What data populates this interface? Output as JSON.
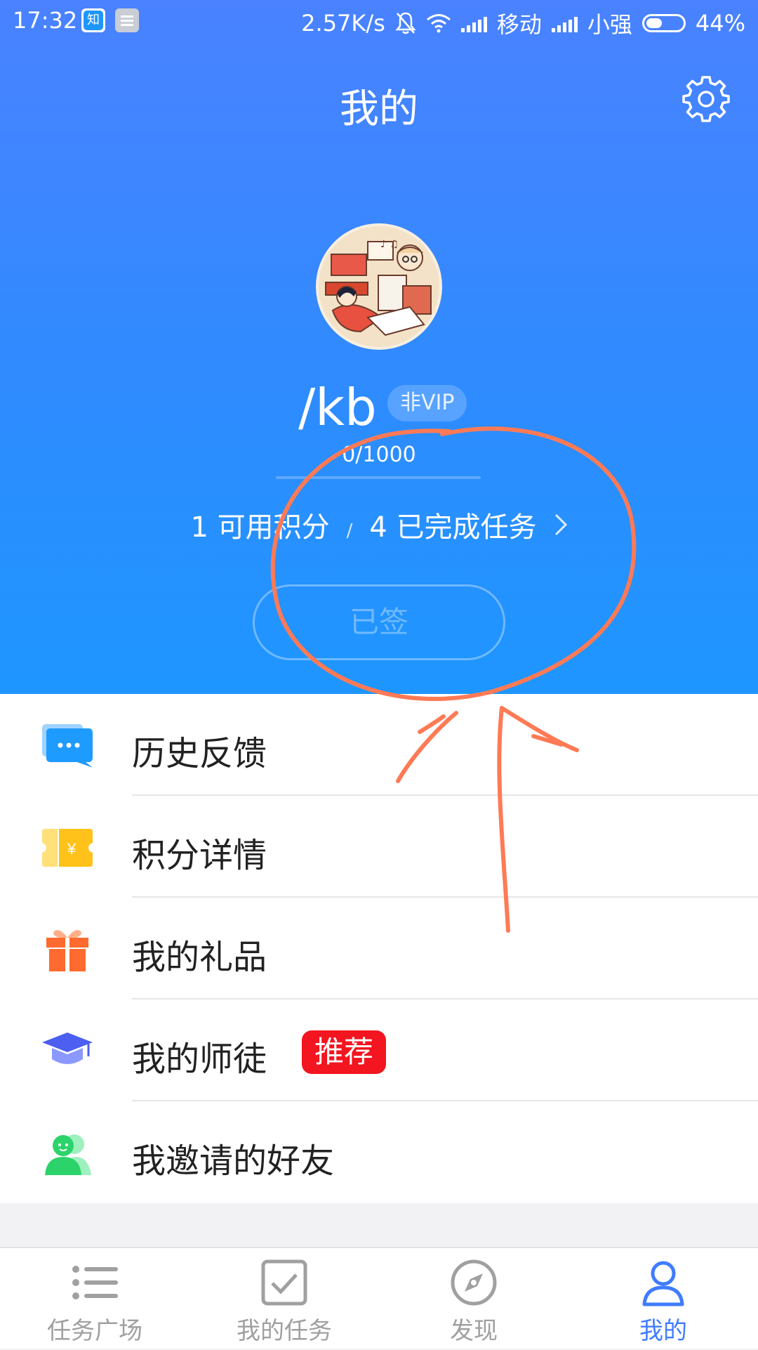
{
  "status_bar": {
    "time": "17:32",
    "notification_app_label": "知",
    "net_speed": "2.57K/s",
    "carrier1": "移动",
    "carrier2": "小强",
    "battery_level": 0.44,
    "battery_text": "44%"
  },
  "header": {
    "title": "我的",
    "settings_icon": "gear-icon",
    "username": "/kb",
    "vip_badge": "非VIP",
    "progress_text": "0/1000",
    "progress_value": 0,
    "points_label": "1 可用积分",
    "separator": "/",
    "tasks_label": "4 已完成任务",
    "signin_button": "已签"
  },
  "menu": [
    {
      "label": "历史反馈",
      "icon": "chat-bubble-icon",
      "color": "#1e9bff"
    },
    {
      "label": "积分详情",
      "icon": "ticket-icon",
      "color": "#ffc21a"
    },
    {
      "label": "我的礼品",
      "icon": "gift-icon",
      "color": "#ff6a2e"
    },
    {
      "label": "我的师徒",
      "icon": "graduation-cap-icon",
      "color": "#6f7fff",
      "badge": "推荐"
    },
    {
      "label": "我邀请的好友",
      "icon": "friends-icon",
      "color": "#2bd36a"
    }
  ],
  "tabbar": [
    {
      "label": "任务广场",
      "icon": "list-icon",
      "active": false
    },
    {
      "label": "我的任务",
      "icon": "checkbox-icon",
      "active": false
    },
    {
      "label": "发现",
      "icon": "compass-icon",
      "active": false
    },
    {
      "label": "我的",
      "icon": "person-icon",
      "active": true
    }
  ],
  "colors": {
    "header_top": "#4a82ff",
    "header_bottom": "#1e96ff",
    "active_tab": "#3f7cff",
    "annotation": "#ff7a55",
    "badge": "#f3151f"
  }
}
